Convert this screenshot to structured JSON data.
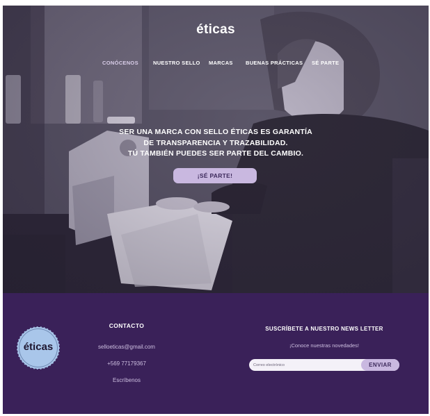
{
  "brand": {
    "logo": "éticas",
    "accent_color": "#c9b8e0",
    "footer_color": "#3a2159",
    "badge_color": "#a9c6ea"
  },
  "nav": {
    "items": [
      "CONÓCENOS",
      "NUESTRO SELLO",
      "MARCAS",
      "BUENAS PRÁCTICAS",
      "SÉ PARTE"
    ],
    "active_index": 0
  },
  "hero": {
    "lines": [
      "SER UNA MARCA CON SELLO ÉTICAS ES GARANTÍA",
      "DE TRANSPARENCIA Y TRAZABILIDAD.",
      "TÚ TAMBIÉN PUEDES SER PARTE DEL CAMBIO."
    ],
    "cta_label": "¡SÉ PARTE!"
  },
  "footer": {
    "badge_text": "éticas",
    "contact": {
      "title": "CONTACTO",
      "email": "selloeticas@gmail.com",
      "phone": "+569 77179367",
      "link": "Escríbenos"
    },
    "newsletter": {
      "title": "SUSCRÍBETE A NUESTRO NEWS LETTER",
      "subtitle": "¡Conoce nuestras novedades!",
      "input_placeholder": "Correo electrónico",
      "button_label": "ENVIAR"
    }
  }
}
